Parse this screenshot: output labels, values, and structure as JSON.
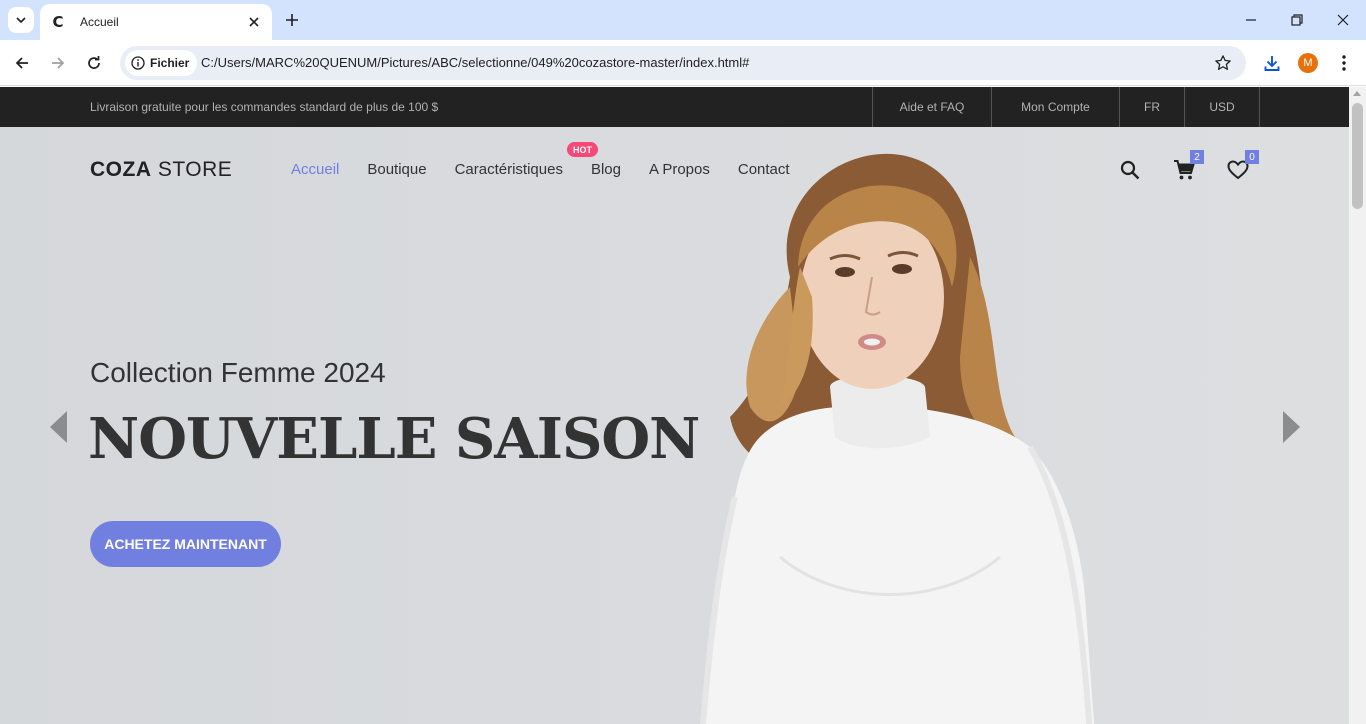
{
  "browser": {
    "tab_title": "Accueil",
    "tab_favicon": "C",
    "chip_label": "Fichier",
    "url": "C:/Users/MARC%20QUENUM/Pictures/ABC/selectionne/049%20cozastore-master/index.html#",
    "profile_initial": "M"
  },
  "topbar": {
    "promo": "Livraison gratuite pour les commandes standard de plus de 100 $",
    "links": [
      "Aide et FAQ",
      "Mon Compte",
      "FR",
      "USD"
    ]
  },
  "header": {
    "logo_bold": "COZA",
    "logo_rest": " STORE",
    "menu": [
      "Accueil",
      "Boutique",
      "Caractéristiques",
      "Blog",
      "A Propos",
      "Contact"
    ],
    "active_item": "Accueil",
    "hot_badge": "HOT",
    "cart_count": "2",
    "wishlist_count": "0"
  },
  "hero": {
    "subtitle": "Collection Femme 2024",
    "headline": "NOUVELLE SAISON",
    "cta": "ACHETEZ MAINTENANT"
  },
  "colors": {
    "accent": "#717fe0",
    "hot": "#f74877",
    "topbar": "#222222",
    "hero_bg": "#d8dadd"
  }
}
